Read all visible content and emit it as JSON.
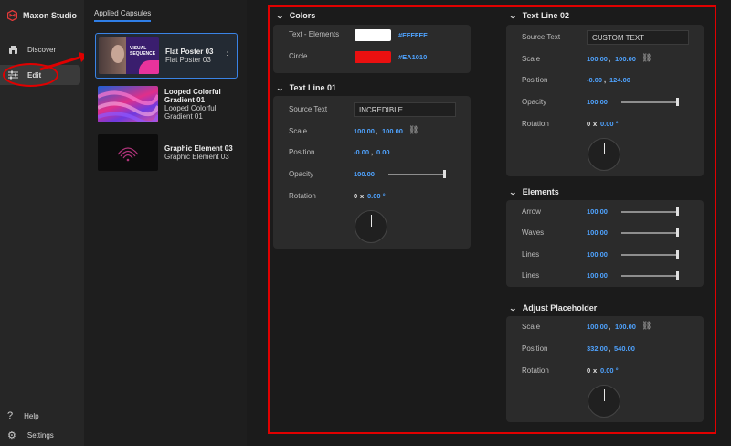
{
  "app": {
    "name": "Maxon Studio"
  },
  "nav": {
    "items": [
      {
        "label": "Discover",
        "icon": "home-icon"
      },
      {
        "label": "Edit",
        "icon": "sliders-icon"
      }
    ],
    "bottom": [
      {
        "label": "Help",
        "icon": "question-icon"
      },
      {
        "label": "Settings",
        "icon": "gear-icon"
      }
    ]
  },
  "capsules": {
    "header": "Applied Capsules",
    "items": [
      {
        "title": "Flat Poster 03",
        "subtitle": "Flat Poster 03",
        "thumb_text": "VISUAL SEQUENCE"
      },
      {
        "title": "Looped Colorful Gradient 01",
        "subtitle": "Looped Colorful Gradient 01"
      },
      {
        "title": "Graphic Element 03",
        "subtitle": "Graphic Element 03"
      }
    ]
  },
  "colors": {
    "title": "Colors",
    "rows": [
      {
        "label": "Text - Elements",
        "hex": "#FFFFFF",
        "swatch": "#FFFFFF"
      },
      {
        "label": "Circle",
        "hex": "#EA1010",
        "swatch": "#EA1010"
      }
    ]
  },
  "text_line_01": {
    "title": "Text Line 01",
    "source_label": "Source Text",
    "source_value": "INCREDIBLE",
    "scale_label": "Scale",
    "scale_x": "100.00",
    "scale_sep": ",",
    "scale_y": "100.00",
    "position_label": "Position",
    "pos_x": "-0.00",
    "pos_sep": ",",
    "pos_y": "0.00",
    "opacity_label": "Opacity",
    "opacity": "100.00",
    "rotation_label": "Rotation",
    "rot_turns": "0",
    "rot_x": "x",
    "rot_deg": "0.00 °"
  },
  "text_line_02": {
    "title": "Text Line 02",
    "source_label": "Source Text",
    "source_value": "CUSTOM TEXT",
    "scale_label": "Scale",
    "scale_x": "100.00",
    "scale_sep": ",",
    "scale_y": "100.00",
    "position_label": "Position",
    "pos_x": "-0.00",
    "pos_sep": ",",
    "pos_y": "124.00",
    "opacity_label": "Opacity",
    "opacity": "100.00",
    "rotation_label": "Rotation",
    "rot_turns": "0",
    "rot_x": "x",
    "rot_deg": "0.00 °"
  },
  "elements": {
    "title": "Elements",
    "rows": [
      {
        "label": "Arrow",
        "value": "100.00"
      },
      {
        "label": "Waves",
        "value": "100.00"
      },
      {
        "label": "Lines",
        "value": "100.00"
      },
      {
        "label": "Lines",
        "value": "100.00"
      }
    ]
  },
  "adjust_placeholder": {
    "title": "Adjust Placeholder",
    "scale_label": "Scale",
    "scale_x": "100.00",
    "scale_sep": ",",
    "scale_y": "100.00",
    "position_label": "Position",
    "pos_x": "332.00",
    "pos_sep": ",",
    "pos_y": "540.00",
    "rotation_label": "Rotation",
    "rot_turns": "0",
    "rot_x": "x",
    "rot_deg": "0.00 °"
  },
  "accent_color": "#4fa3ff",
  "annotation_color": "#e00000"
}
